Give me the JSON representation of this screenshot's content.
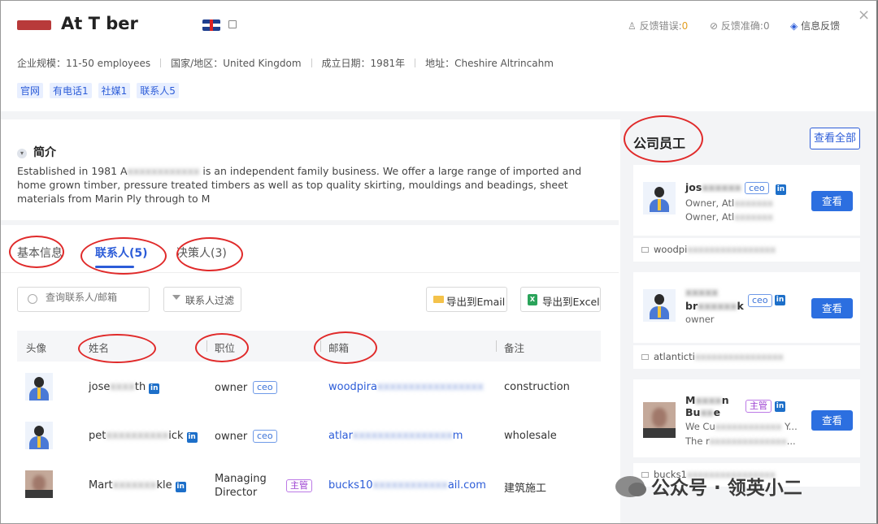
{
  "header": {
    "company_name": "At      T     ber",
    "feedback_error_label": "反馈错误:",
    "feedback_error_count": "0",
    "feedback_accurate_label": "反馈准确:",
    "feedback_accurate_count": "0",
    "info_feedback": "信息反馈",
    "close": "×",
    "meta": [
      "企业规模：11-50 employees",
      "国家/地区：United Kingdom",
      "成立日期：1981年",
      "地址：Cheshire Altrincahm"
    ],
    "tags": [
      "官网",
      "有电话1",
      "社媒1",
      "联系人5"
    ]
  },
  "intro": {
    "title": "简介",
    "text_a": "Established in 1981 A",
    "text_blur": "xxxxxxxxxxxx",
    "text_b": " is an independent family business. We offer a large range of imported and home grown timber, pressure treated timbers as well as top quality skirting, mouldings and beadings, sheet materials from Marin Ply through to M"
  },
  "tabs": [
    "基本信息",
    "联系人(5)",
    "决策人(3)"
  ],
  "toolbar": {
    "search_placeholder": "查询联系人/邮箱",
    "filter": "联系人过滤",
    "export_email": "导出到Email",
    "export_excel": "导出到Excel",
    "excel_icon_letter": "X"
  },
  "table": {
    "headers": [
      "头像",
      "姓名",
      "职位",
      "邮箱",
      "备注"
    ],
    "rows": [
      {
        "name_a": "jose",
        "name_blur": "xxxx",
        "name_b": "th",
        "position": "owner",
        "badge": "ceo",
        "email_a": "woodpira",
        "email_blur": "xxxxxxxxxxxxxxxxx",
        "note": "construction"
      },
      {
        "name_a": "pet",
        "name_blur": "xxxxxxxxxx",
        "name_b": "ick",
        "position": "owner",
        "badge": "ceo",
        "email_a": "atlar",
        "email_blur": "xxxxxxxxxxxxxxxx",
        "email_b": "m",
        "note": "wholesale"
      },
      {
        "name_a": "Mart",
        "name_blur": "xxxxxxx",
        "name_b": "kle",
        "position_l1": "Managing",
        "position_l2": "Director",
        "badge": "主管",
        "email_a": "bucks10",
        "email_blur": "xxxxxxxxxxxx",
        "email_b": "ail.com",
        "note": "建筑施工"
      }
    ],
    "linkedin_icon_letter": "in"
  },
  "right_panel": {
    "title": "公司员工",
    "view_all": "查看全部",
    "view_label": "查看",
    "cards": [
      {
        "name_a": "jos",
        "name_blur": "xxxxxx",
        "badge": "ceo",
        "sub1_a": "Owner, Atl",
        "sub1_blur": "xxxxxxx",
        "sub2_a": "Owner, Atl",
        "sub2_blur": "xxxxxxx",
        "email_a": "woodpi",
        "email_blur": "xxxxxxxxxxxxxxxx"
      },
      {
        "name_l1_blur": "xxxxx",
        "name_l2_a": "br",
        "name_l2_blur": "xxxxxx",
        "name_l2_b": "k",
        "badge": "ceo",
        "sub1": "owner",
        "email_a": "atlanticti",
        "email_blur": "xxxxxxxxxxxxxxxx"
      },
      {
        "name_l1_a": "M",
        "name_l1_blur": "xxxx",
        "name_l1_b": "n",
        "name_l2_a": "Bu",
        "name_l2_blur": "xx",
        "name_l2_b": "e",
        "badge": "主管",
        "sub1_a": "We Cu",
        "sub1_blur": "xxxxxxxxxxxx",
        "sub1_b": " Y...",
        "sub2_a": "The r",
        "sub2_blur": "xxxxxxxxxxxxxx",
        "sub2_b": "...",
        "email_a": "bucks1",
        "email_blur": "xxxxxxxxxxxxxxxx"
      }
    ]
  },
  "watermark": "公众号 · 领英小二",
  "colors": {
    "accent": "#2c5cd8",
    "annotation_red": "#e02a2a",
    "button_blue": "#2c6fe0"
  }
}
